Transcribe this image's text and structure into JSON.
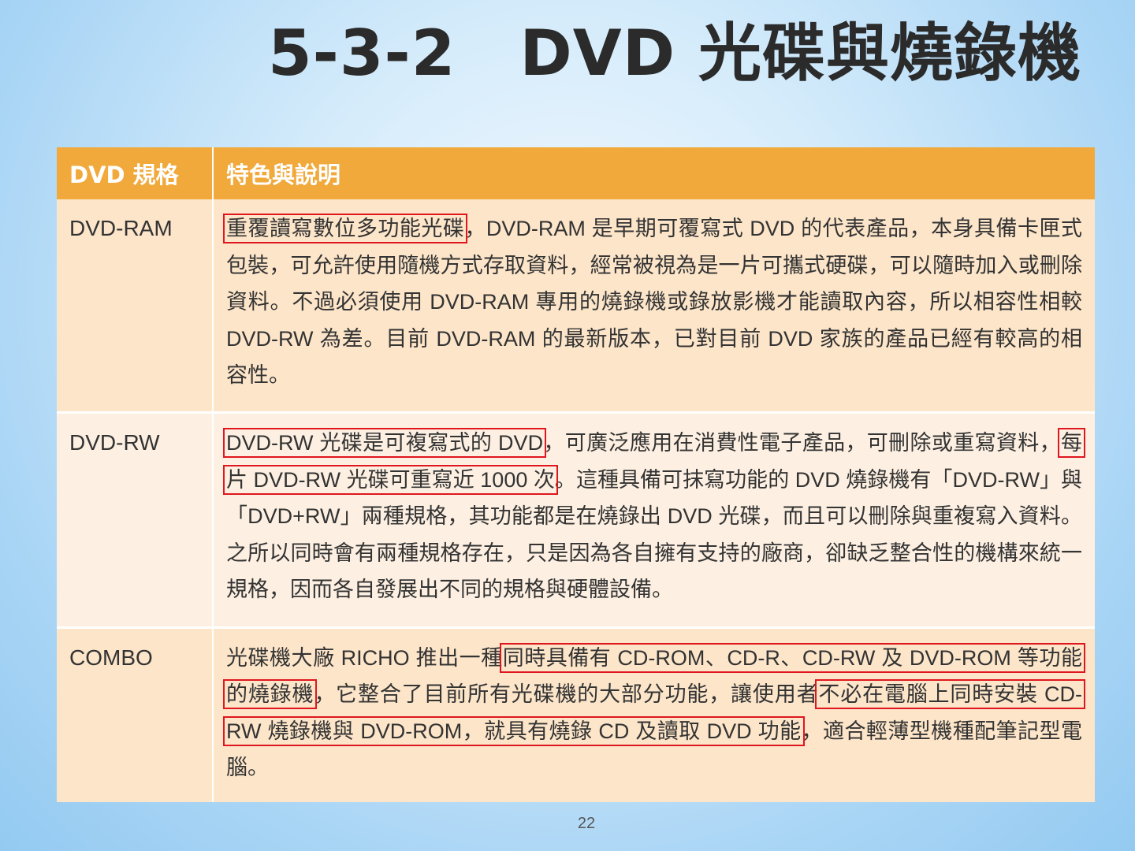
{
  "slide": {
    "title": "5-3-2　DVD 光碟與燒錄機",
    "page_number": "22"
  },
  "table": {
    "headers": [
      "DVD 規格",
      "特色與說明"
    ],
    "rows": [
      {
        "name": "DVD-RAM",
        "parts": [
          {
            "text": "重覆讀寫數位多功能光碟",
            "highlight": true
          },
          {
            "text": "，DVD-RAM 是早期可覆寫式 DVD 的代表產品，本身具備卡匣式包裝，可允許使用隨機方式存取資料，經常被視為是一片可攜式硬碟，可以隨時加入或刪除資料。不過必須使用 DVD-RAM 專用的燒錄機或錄放影機才能讀取內容，所以相容性相較 DVD-RW 為差。目前 DVD-RAM 的最新版本，已對目前 DVD 家族的產品已經有較高的相容性。",
            "highlight": false
          }
        ]
      },
      {
        "name": "DVD-RW",
        "parts": [
          {
            "text": "DVD-RW 光碟是可複寫式的 DVD",
            "highlight": true
          },
          {
            "text": "，可廣泛應用在消費性電子產品，可刪除或重寫資料，",
            "highlight": false
          },
          {
            "text": "每片 DVD-RW 光碟可重寫近 1000 次",
            "highlight": true
          },
          {
            "text": "。這種具備可抹寫功能的 DVD 燒錄機有「DVD-RW」與「DVD+RW」兩種規格，其功能都是在燒錄出 DVD 光碟，而且可以刪除與重複寫入資料。之所以同時會有兩種規格存在，只是因為各自擁有支持的廠商，卻缺乏整合性的機構來統一規格，因而各自發展出不同的規格與硬體設備。",
            "highlight": false
          }
        ]
      },
      {
        "name": "COMBO",
        "parts": [
          {
            "text": "光碟機大廠 RICHO 推出一種",
            "highlight": false
          },
          {
            "text": "同時具備有 CD-ROM、CD-R、CD-RW 及 DVD-ROM 等功能的燒錄機",
            "highlight": true
          },
          {
            "text": "，它整合了目前所有光碟機的大部分功能，讓使用者",
            "highlight": false
          },
          {
            "text": "不必在電腦上同時安裝 CD-RW 燒錄機與 DVD-ROM，就具有燒錄 CD 及讀取 DVD 功能",
            "highlight": true
          },
          {
            "text": "，適合輕薄型機種配筆記型電腦。",
            "highlight": false
          }
        ]
      }
    ]
  },
  "colors": {
    "header_bg": "#f0a93a",
    "row_bg": "#fce5c9",
    "row_bg_alt": "#fdf0e2",
    "highlight_border": "#e0161e",
    "title_text": "#2b2b2b"
  }
}
